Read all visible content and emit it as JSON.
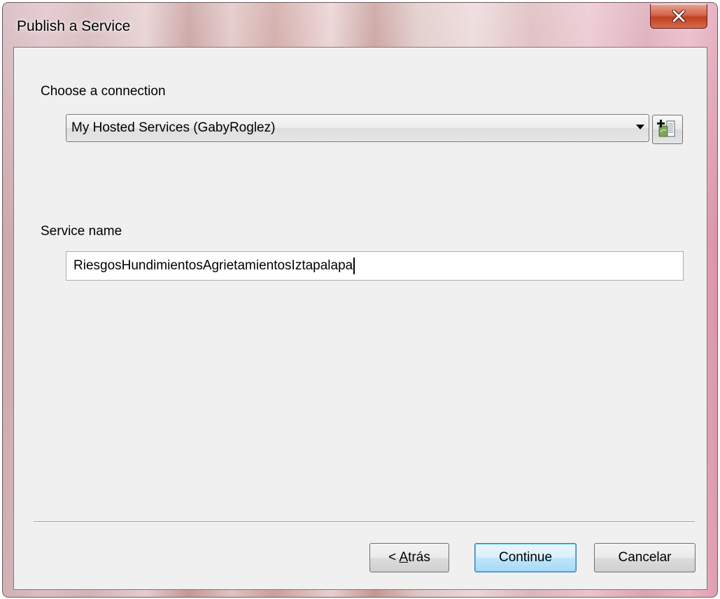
{
  "window": {
    "title": "Publish a Service"
  },
  "connection": {
    "label": "Choose a connection",
    "selected": "My Hosted Services (GabyRoglez)"
  },
  "service": {
    "label": "Service name",
    "value": "RiesgosHundimientosAgrietamientosIztapalapa"
  },
  "buttons": {
    "back_prefix": "< ",
    "back_mnemonic": "A",
    "back_rest": "trás",
    "continue": "Continue",
    "cancel": "Cancelar"
  },
  "icons": {
    "close": "close-icon",
    "add_connection": "add-connection-icon",
    "dropdown": "chevron-down-icon"
  },
  "colors": {
    "close_button": "#c2401f",
    "default_button_border": "#3c7fb1",
    "client_background": "#f0f0f0"
  }
}
